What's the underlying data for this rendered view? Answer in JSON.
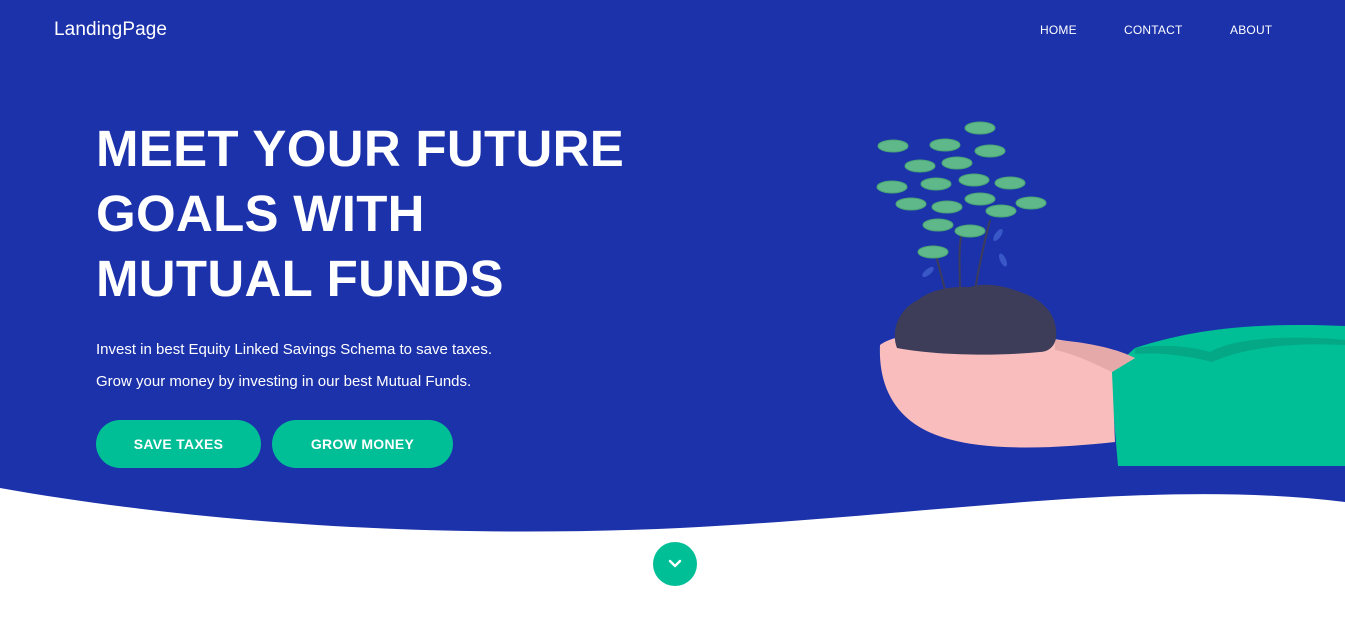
{
  "header": {
    "brand": "LandingPage",
    "nav": [
      "HOME",
      "CONTACT",
      "ABOUT"
    ]
  },
  "hero": {
    "headline": [
      "MEET YOUR FUTURE",
      "GOALS WITH",
      "MUTUAL FUNDS"
    ],
    "subtext": [
      "Invest in best Equity Linked Savings Schema to save taxes.",
      "Grow your money by investing in our best Mutual Funds."
    ],
    "buttons": {
      "save_taxes": "SAVE TAXES",
      "grow_money": "GROW MONEY"
    }
  },
  "scroll": {
    "icon": "chevron-down-icon"
  },
  "colors": {
    "hero_bg": "#1b32ab",
    "accent": "#00bf96",
    "leaf": "#5fb88a",
    "soil": "#3e3d59",
    "hand": "#f9bdbd",
    "sleeve": "#00bf96"
  }
}
